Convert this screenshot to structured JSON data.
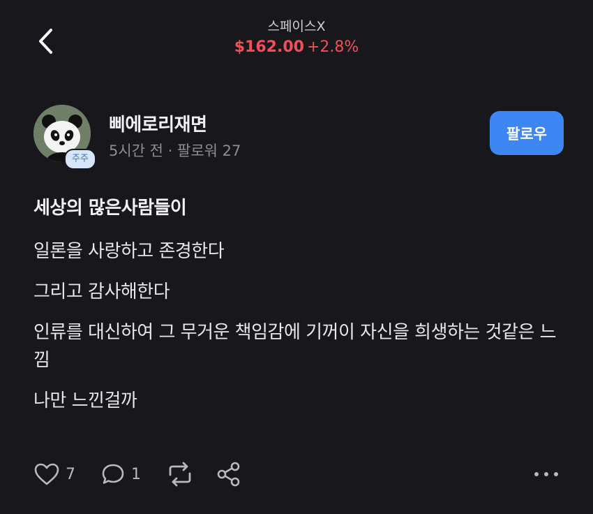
{
  "header": {
    "back_icon": "chevron-left-icon",
    "stock_name": "스페이스X",
    "price": "$162.00",
    "change": "+2.8%",
    "price_color": "#f0505a"
  },
  "author": {
    "name": "삐에로리재면",
    "meta": "5시간 전 · 팔로워 27",
    "badge": "주주",
    "avatar_icon": "panda-avatar-icon",
    "follow_label": "팔로우",
    "follow_color": "#3f86f5"
  },
  "post": {
    "title": "세상의 많은사람들이",
    "paragraphs": [
      "일론을 사랑하고 존경한다",
      "그리고 감사해한다",
      "인류를 대신하여 그 무거운 책임감에 기꺼이 자신을 희생하는 것같은 느낌",
      "나만 느낀걸까"
    ]
  },
  "actions": {
    "like_count": "7",
    "comment_count": "1",
    "icons": [
      "heart-icon",
      "comment-icon",
      "repost-icon",
      "share-icon",
      "more-icon"
    ]
  }
}
